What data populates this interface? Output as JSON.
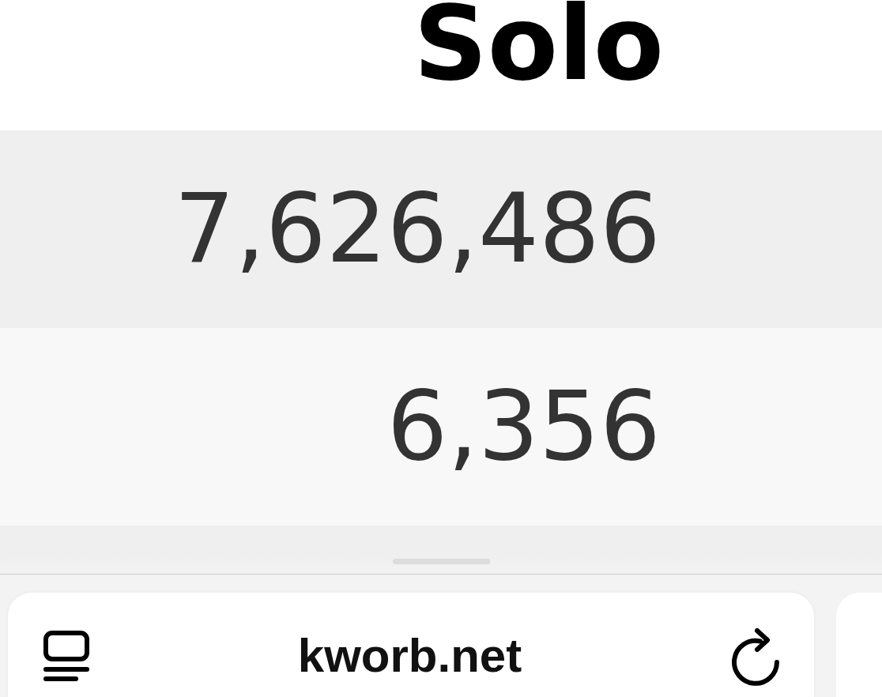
{
  "table": {
    "columns": [
      {
        "label": "Solo"
      }
    ],
    "rows": [
      {
        "cells": [
          "7,626,486"
        ]
      },
      {
        "cells": [
          "6,356"
        ]
      }
    ]
  },
  "browser_toolbar": {
    "address": "kworb.net"
  }
}
